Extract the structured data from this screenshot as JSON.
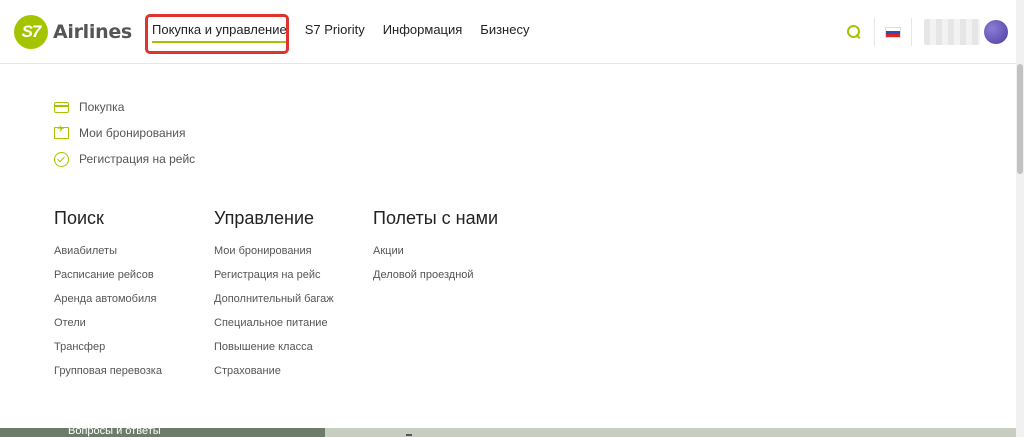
{
  "brand": {
    "logo_text": "S7",
    "name": "Airlines",
    "accent": "#a5c400"
  },
  "nav": {
    "items": [
      {
        "label": "Покупка и управление",
        "active": true
      },
      {
        "label": "S7 Priority"
      },
      {
        "label": "Информация"
      },
      {
        "label": "Бизнесу"
      }
    ]
  },
  "header_right": {
    "search_icon": "search-icon",
    "language_flag": "ru-flag",
    "avatar_icon": "avatar"
  },
  "quick_links": [
    {
      "icon": "card-icon",
      "label": "Покупка"
    },
    {
      "icon": "ticket-icon",
      "label": "Мои бронирования"
    },
    {
      "icon": "check-circle-icon",
      "label": "Регистрация на рейс"
    }
  ],
  "columns": [
    {
      "title": "Поиск",
      "links": [
        "Авиабилеты",
        "Расписание рейсов",
        "Аренда автомобиля",
        "Отели",
        "Трансфер",
        "Групповая перевозка"
      ]
    },
    {
      "title": "Управление",
      "links": [
        "Мои бронирования",
        "Регистрация на рейс",
        "Дополнительный багаж",
        "Специальное питание",
        "Повышение класса",
        "Страхование"
      ]
    },
    {
      "title": "Полеты с нами",
      "links": [
        "Акции",
        "Деловой проездной"
      ]
    }
  ],
  "bottom": {
    "text": "Вопросы и ответы"
  },
  "colors": {
    "highlight_box": "#e0322e",
    "text": "#333333"
  }
}
